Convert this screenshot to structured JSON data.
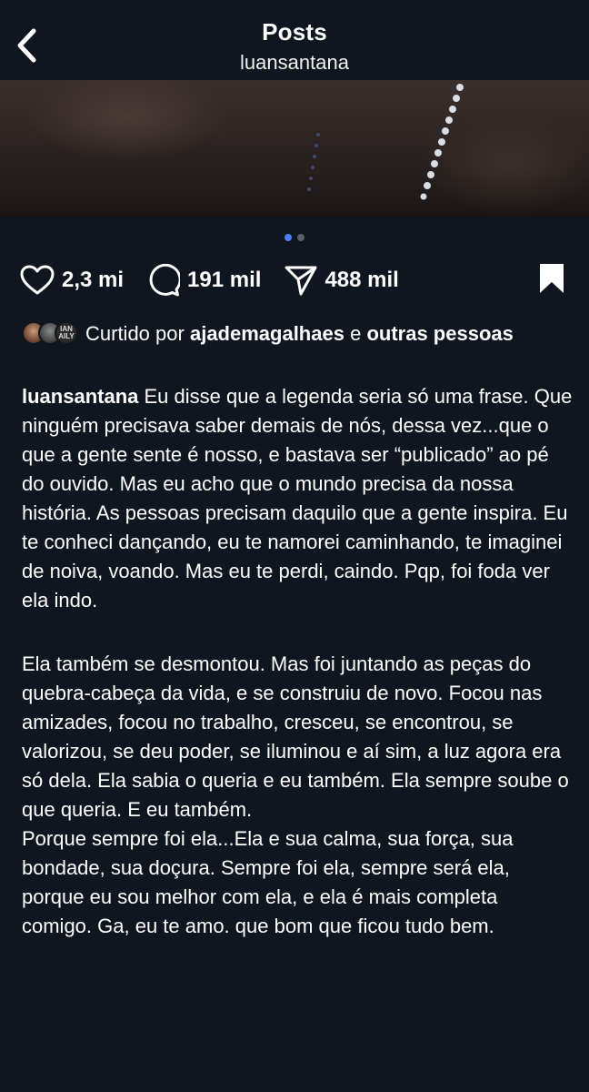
{
  "header": {
    "title": "Posts",
    "username": "luansantana"
  },
  "carousel": {
    "total": 2,
    "active_index": 0
  },
  "actions": {
    "likes": "2,3 mi",
    "comments": "191 mil",
    "shares": "488 mil"
  },
  "liked_by": {
    "prefix": "Curtido por",
    "user": "ajademagalhaes",
    "connector": "e",
    "rest": "outras pessoas",
    "avatar_badge": "IAN AILY"
  },
  "caption": {
    "author": "luansantana",
    "paragraph1": "Eu disse que a legenda seria só uma frase. Que ninguém precisava saber demais de nós, dessa vez...que o que a gente sente é nosso, e bastava ser “publicado” ao pé do ouvido. Mas eu acho que o mundo precisa da nossa história. As pessoas precisam daquilo que a gente inspira. Eu te conheci dançando, eu te namorei caminhando, te imaginei de noiva, voando. Mas eu te perdi, caindo. Pqp, foi foda ver ela indo.",
    "paragraph2": "Ela também se desmontou. Mas foi juntando as peças do quebra-cabeça da vida, e se construiu de novo. Focou nas amizades, focou no trabalho, cresceu, se encontrou, se valorizou, se deu poder, se iluminou e aí sim, a luz agora era só dela. Ela sabia o queria e eu também. Ela sempre soube o que queria. E eu também.",
    "paragraph3": "Porque sempre foi ela...Ela e sua calma, sua força, sua bondade, sua doçura. Sempre foi ela, sempre será ela, porque eu sou melhor com ela, e ela é mais completa comigo. Ga, eu te amo. que bom que ficou tudo bem."
  },
  "colors": {
    "background": "#0f1620",
    "text": "#ffffff",
    "carousel_active": "#4a7dff",
    "carousel_inactive": "#5b6169"
  },
  "icons": {
    "back": "chevron-left-icon",
    "like": "heart-icon",
    "comment": "comment-bubble-icon",
    "share": "paper-plane-icon",
    "save": "bookmark-icon"
  }
}
